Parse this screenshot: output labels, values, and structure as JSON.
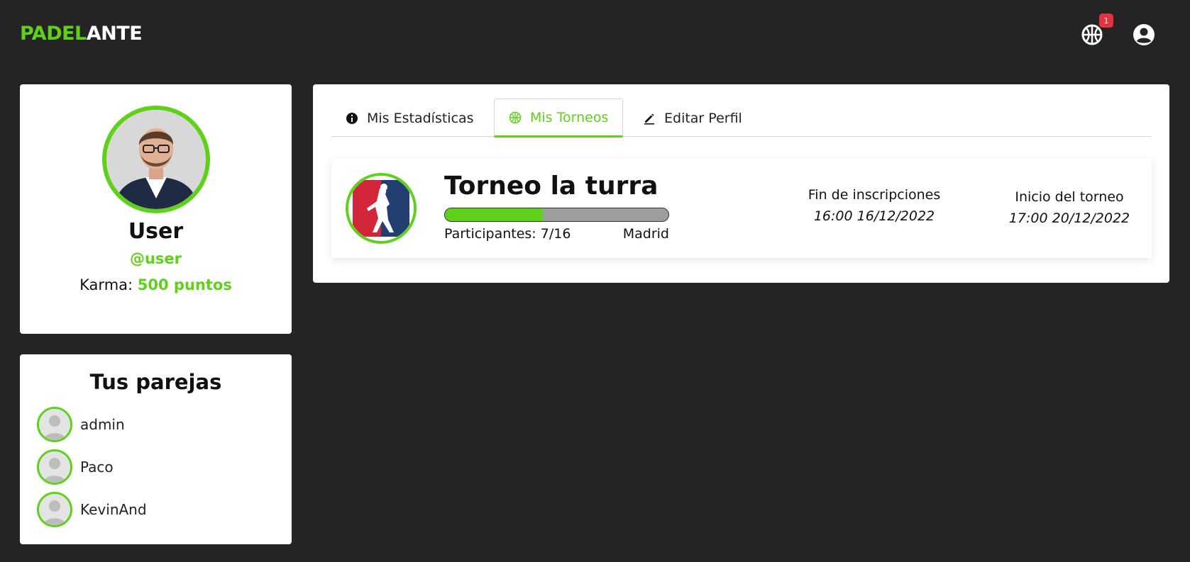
{
  "brand": {
    "part1": "PADEL",
    "part2": "ANTE"
  },
  "header": {
    "notifications_count": "1",
    "tournament_icon": "basketball-icon",
    "account_icon": "user-circle-icon"
  },
  "profile": {
    "name": "User",
    "handle": "@user",
    "karma_label": "Karma:",
    "karma_value": "500 puntos"
  },
  "partners": {
    "title": "Tus parejas",
    "items": [
      {
        "name": "admin"
      },
      {
        "name": "Paco"
      },
      {
        "name": "KevinAnd"
      }
    ]
  },
  "tabs": [
    {
      "label": "Mis Estadísticas",
      "icon": "info-icon",
      "active": false
    },
    {
      "label": "Mis Torneos",
      "icon": "basketball-icon",
      "active": true
    },
    {
      "label": "Editar Perfil",
      "icon": "pencil-icon",
      "active": false
    }
  ],
  "tournament": {
    "name": "Torneo la turra",
    "participants_text": "Participantes: 7/16",
    "participants_current": 7,
    "participants_max": 16,
    "city": "Madrid",
    "registration_end_label": "Fin de inscripciones",
    "registration_end_value": "16:00 16/12/2022",
    "start_label": "Inicio del torneo",
    "start_value": "17:00 20/12/2022"
  },
  "colors": {
    "accent": "#5fd11a",
    "background": "#242424",
    "badge": "#e5323f"
  }
}
